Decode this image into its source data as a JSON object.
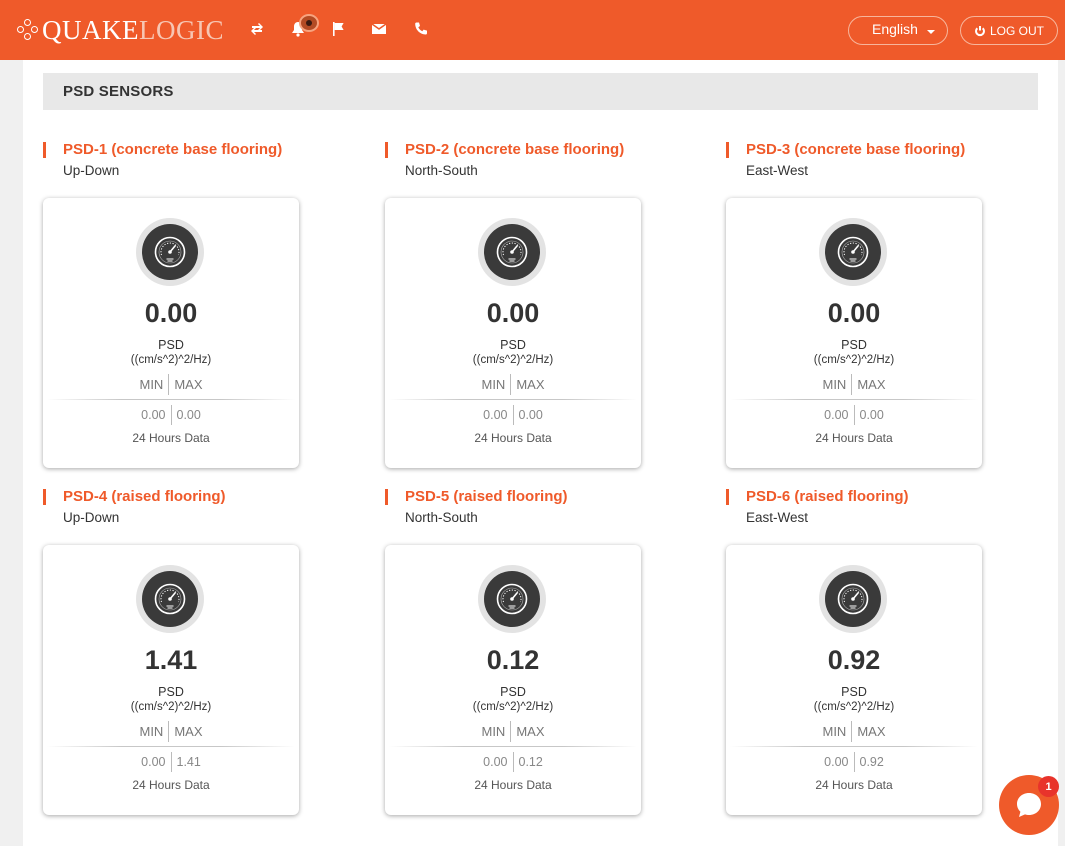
{
  "brand": {
    "part1": "QUAKE",
    "part2": "LOGIC"
  },
  "header": {
    "language": "English",
    "logout_label": "LOG OUT",
    "icons": [
      "swap-icon",
      "bell-icon",
      "flag-icon",
      "mail-icon",
      "phone-icon"
    ]
  },
  "section": {
    "title": "PSD SENSORS"
  },
  "sensors": [
    {
      "title": "PSD-1 (concrete base flooring)",
      "direction": "Up-Down",
      "value": "0.00",
      "label": "PSD",
      "unit": "((cm/s^2)^2/Hz)",
      "min_label": "MIN",
      "max_label": "MAX",
      "min": "0.00",
      "max": "0.00",
      "period": "24 Hours Data"
    },
    {
      "title": "PSD-2 (concrete base flooring)",
      "direction": "North-South",
      "value": "0.00",
      "label": "PSD",
      "unit": "((cm/s^2)^2/Hz)",
      "min_label": "MIN",
      "max_label": "MAX",
      "min": "0.00",
      "max": "0.00",
      "period": "24 Hours Data"
    },
    {
      "title": "PSD-3 (concrete base flooring)",
      "direction": "East-West",
      "value": "0.00",
      "label": "PSD",
      "unit": "((cm/s^2)^2/Hz)",
      "min_label": "MIN",
      "max_label": "MAX",
      "min": "0.00",
      "max": "0.00",
      "period": "24 Hours Data"
    },
    {
      "title": "PSD-4 (raised flooring)",
      "direction": "Up-Down",
      "value": "1.41",
      "label": "PSD",
      "unit": "((cm/s^2)^2/Hz)",
      "min_label": "MIN",
      "max_label": "MAX",
      "min": "0.00",
      "max": "1.41",
      "period": "24 Hours Data"
    },
    {
      "title": "PSD-5 (raised flooring)",
      "direction": "North-South",
      "value": "0.12",
      "label": "PSD",
      "unit": "((cm/s^2)^2/Hz)",
      "min_label": "MIN",
      "max_label": "MAX",
      "min": "0.00",
      "max": "0.12",
      "period": "24 Hours Data"
    },
    {
      "title": "PSD-6 (raised flooring)",
      "direction": "East-West",
      "value": "0.92",
      "label": "PSD",
      "unit": "((cm/s^2)^2/Hz)",
      "min_label": "MIN",
      "max_label": "MAX",
      "min": "0.00",
      "max": "0.92",
      "period": "24 Hours Data"
    }
  ],
  "chat": {
    "badge": "1"
  },
  "colors": {
    "accent": "#ef5a2a",
    "gauge": "#3a3a3a"
  }
}
